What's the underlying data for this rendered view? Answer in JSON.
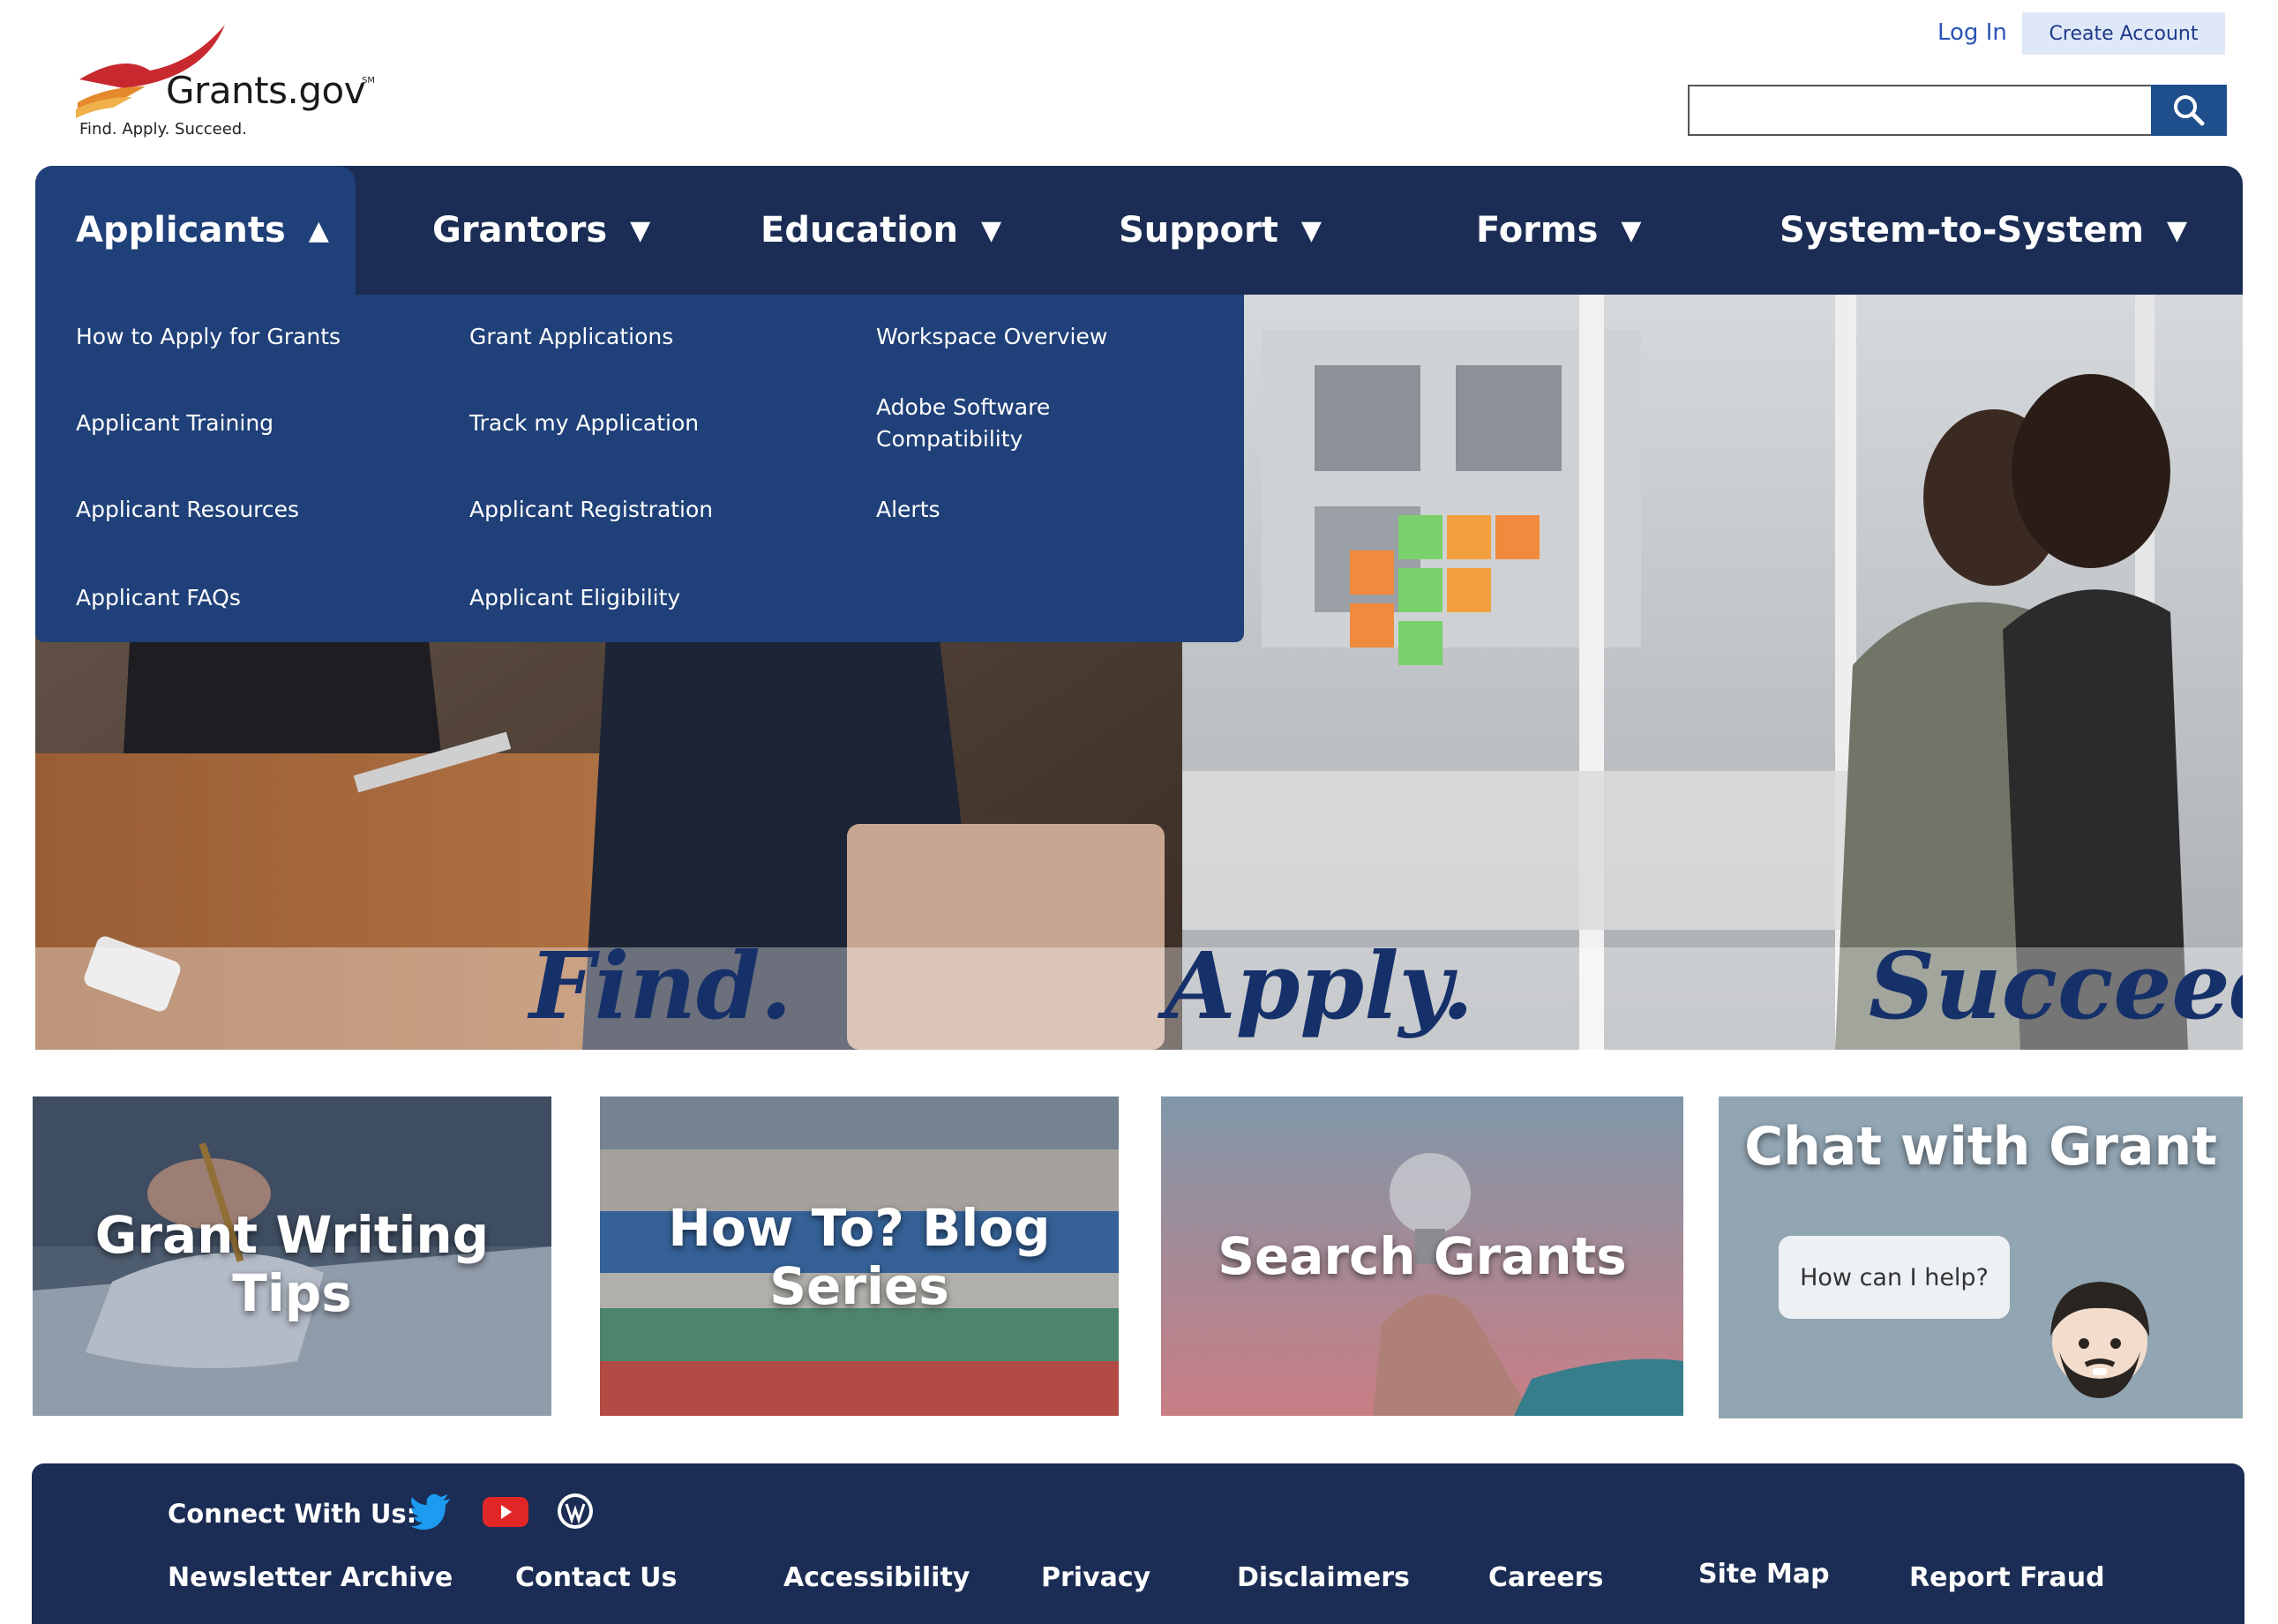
{
  "colors": {
    "navy": "#1b2d54",
    "nav_active": "#1f4078",
    "link_blue": "#2a55b5",
    "hero_text": "#16306a"
  },
  "header": {
    "logo_text": "Grants.gov",
    "logo_sm": "SM",
    "tagline": "Find. Apply. Succeed.",
    "login": "Log In",
    "create_account": "Create Account",
    "search_placeholder": "",
    "search_icon": "search-icon"
  },
  "nav": [
    {
      "label": "Applicants",
      "caret": "▲"
    },
    {
      "label": "Grantors",
      "caret": "▼"
    },
    {
      "label": "Education",
      "caret": "▼"
    },
    {
      "label": "Support",
      "caret": "▼"
    },
    {
      "label": "Forms",
      "caret": "▼"
    },
    {
      "label": "System-to-System",
      "caret": "▼"
    }
  ],
  "dropdown": {
    "col1": [
      "How to Apply for Grants",
      "Applicant Training",
      "Applicant Resources",
      "Applicant FAQs"
    ],
    "col2": [
      "Grant Applications",
      "Track my Application",
      "Applicant Registration",
      "Applicant Eligibility"
    ],
    "col3": [
      "Workspace Overview",
      "Adobe Software Compatibility",
      "Alerts"
    ]
  },
  "hero": {
    "find": "Find.",
    "apply": "Apply.",
    "succeed": "Succeed."
  },
  "cards": [
    {
      "title": "Grant Writing Tips"
    },
    {
      "title": "How To? Blog Series"
    },
    {
      "title": "Search Grants"
    },
    {
      "title": "Chat with Grant",
      "bubble": "How can I help?"
    }
  ],
  "footer": {
    "connect": "Connect With Us:",
    "social": [
      "twitter-icon",
      "youtube-icon",
      "wordpress-icon"
    ],
    "links": [
      "Newsletter Archive",
      "Contact Us",
      "Accessibility",
      "Privacy",
      "Disclaimers",
      "Careers",
      "Site Map",
      "Report Fraud"
    ]
  }
}
